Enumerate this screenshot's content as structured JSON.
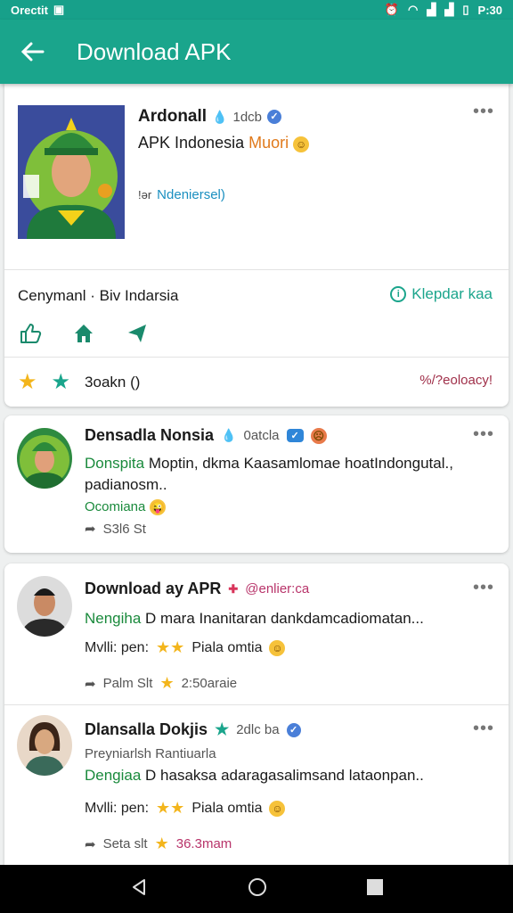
{
  "status_bar": {
    "carrier": "Orectit",
    "sim_icon": "sim-icon",
    "time": "P:30"
  },
  "app_bar": {
    "title": "Download APK"
  },
  "featured": {
    "name": "Ardonall",
    "handle": "1dcb",
    "subtitle_main": "APK Indonesia ",
    "subtitle_accent": "Muori",
    "link_prefix": "!ər",
    "link_text": "Ndeniersel)",
    "company": "Cenymanl · Biv Indarsia",
    "right_link": "Klepdar kaa",
    "bottom_label": "3oakn ()",
    "percent": "%/?eoloacy!"
  },
  "posts": [
    {
      "name": "Densadla Nonsia",
      "badge_text": "0atcla",
      "line1_green": "Donspita",
      "line1_rest": " Moptin, dkma Kaasamlomae hoatIndongutal.,",
      "line2": "padianosm..",
      "line3_green": "Ocomiana",
      "count": "S3l6 St"
    },
    {
      "name": "Download ay APR",
      "handle": "@enlier:ca",
      "line1_green": "Nengiha",
      "line1_rest": " D mara Inanitaran dankdamcadiomatan...",
      "rating_label": "Mvlli: pen:",
      "rating_text": "Piala omtia",
      "meta_label": "Palm Slt",
      "meta_time": "2:50araie"
    },
    {
      "name": "Dlansalla Dokjis",
      "handle": "2dlc ba",
      "subline": "Preyniarlsh Rantiuarla",
      "line1_green": "Dengiaa",
      "line1_rest": " D hasaksa adaragasalimsand lataonpan..",
      "rating_label": "Mvlli: pen:",
      "rating_text": "Piala omtia",
      "meta_label": "Seta slt",
      "meta_time": "36.3mam"
    }
  ],
  "colors": {
    "primary": "#1aa58c",
    "star": "#f3b51c",
    "link": "#1a8fc0"
  }
}
